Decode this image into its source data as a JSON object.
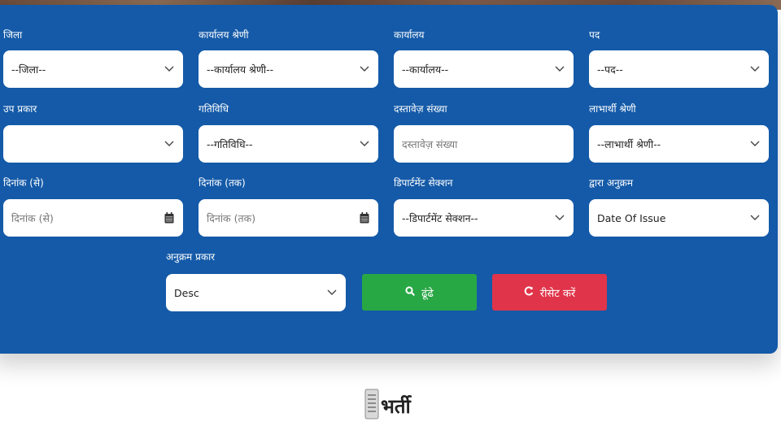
{
  "filters": {
    "district": {
      "label": "जिला",
      "value": "--जिला--"
    },
    "office_category": {
      "label": "कार्यालय श्रेणी",
      "value": "--कार्यालय श्रेणी--"
    },
    "office": {
      "label": "कार्यालय",
      "value": "--कार्यालय--"
    },
    "post": {
      "label": "पद",
      "value": "--पद--"
    },
    "sub_type": {
      "label": "उप प्रकार",
      "value": ""
    },
    "activity": {
      "label": "गतिविधि",
      "value": "--गतिविधि--"
    },
    "document_number": {
      "label": "दस्तावेज़ संख्या",
      "placeholder": "दस्तावेज़ संख्या"
    },
    "beneficiary_category": {
      "label": "लाभार्थी श्रेणी",
      "value": "--लाभार्थी श्रेणी--"
    },
    "date_from": {
      "label": "दिनांक (से)",
      "placeholder": "दिनांक (से)"
    },
    "date_to": {
      "label": "दिनांक (तक)",
      "placeholder": "दिनांक (तक)"
    },
    "department_section": {
      "label": "डिपार्टमेंट सेक्शन",
      "value": "--डिपार्टमेंट सेक्शन--"
    },
    "sort_by": {
      "label": "द्वारा अनुक्रम",
      "value": "Date Of Issue"
    },
    "sort_type": {
      "label": "अनुक्रम प्रकार",
      "value": "Desc"
    }
  },
  "buttons": {
    "search_label": "ढूंढे",
    "reset_label": "रीसेट करें"
  },
  "section": {
    "title": "भर्ती"
  },
  "colors": {
    "panel": "#145aa8",
    "search": "#28a745",
    "reset": "#e0344a"
  }
}
